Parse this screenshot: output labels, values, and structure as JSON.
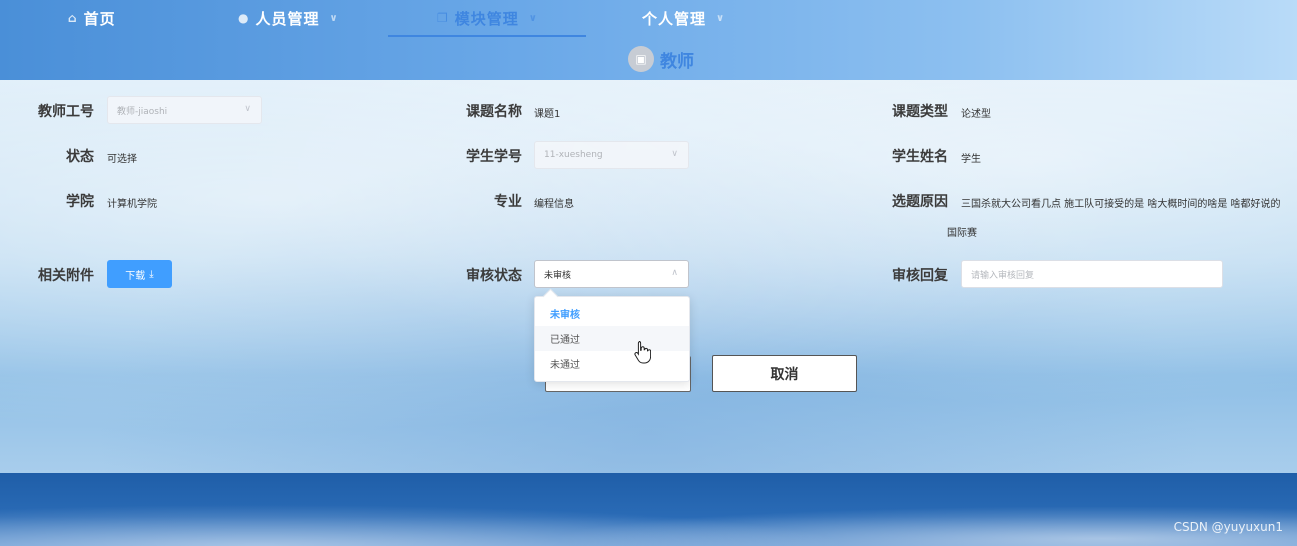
{
  "nav": {
    "items": [
      {
        "label": "首页",
        "icon": "home-icon",
        "has_dropdown": false
      },
      {
        "label": "人员管理",
        "icon": "user-icon",
        "has_dropdown": true
      },
      {
        "label": "模块管理",
        "icon": "copy-icon",
        "has_dropdown": true
      },
      {
        "label": "个人管理",
        "icon": "",
        "has_dropdown": true
      }
    ],
    "active_index": 2
  },
  "page_title": "教师",
  "form": {
    "teacher_id": {
      "label": "教师工号",
      "value": "教师-jiaoshi"
    },
    "topic_name": {
      "label": "课题名称",
      "value": "课题1"
    },
    "topic_type": {
      "label": "课题类型",
      "value": "论述型"
    },
    "status": {
      "label": "状态",
      "value": "可选择"
    },
    "student_id": {
      "label": "学生学号",
      "value": "11-xuesheng"
    },
    "student_name": {
      "label": "学生姓名",
      "value": "学生"
    },
    "college": {
      "label": "学院",
      "value": "计算机学院"
    },
    "major": {
      "label": "专业",
      "value": "编程信息"
    },
    "reason": {
      "label": "选题原因",
      "value_line1": "三国杀就大公司看几点 施工队可接受的是 啥大概时间的啥是 啥都好说的",
      "value_line2": "国际赛"
    },
    "attachment": {
      "label": "相关附件",
      "button": "下载"
    },
    "review_status": {
      "label": "审核状态",
      "value": "未审核",
      "options": [
        "未审核",
        "已通过",
        "未通过"
      ]
    },
    "review_reply": {
      "label": "审核回复",
      "placeholder": "请输入审核回复"
    }
  },
  "buttons": {
    "cancel": "取消"
  },
  "watermark": "CSDN @yuyuxun1",
  "colors": {
    "accent": "#409eff",
    "nav_active": "#3f86e0"
  }
}
